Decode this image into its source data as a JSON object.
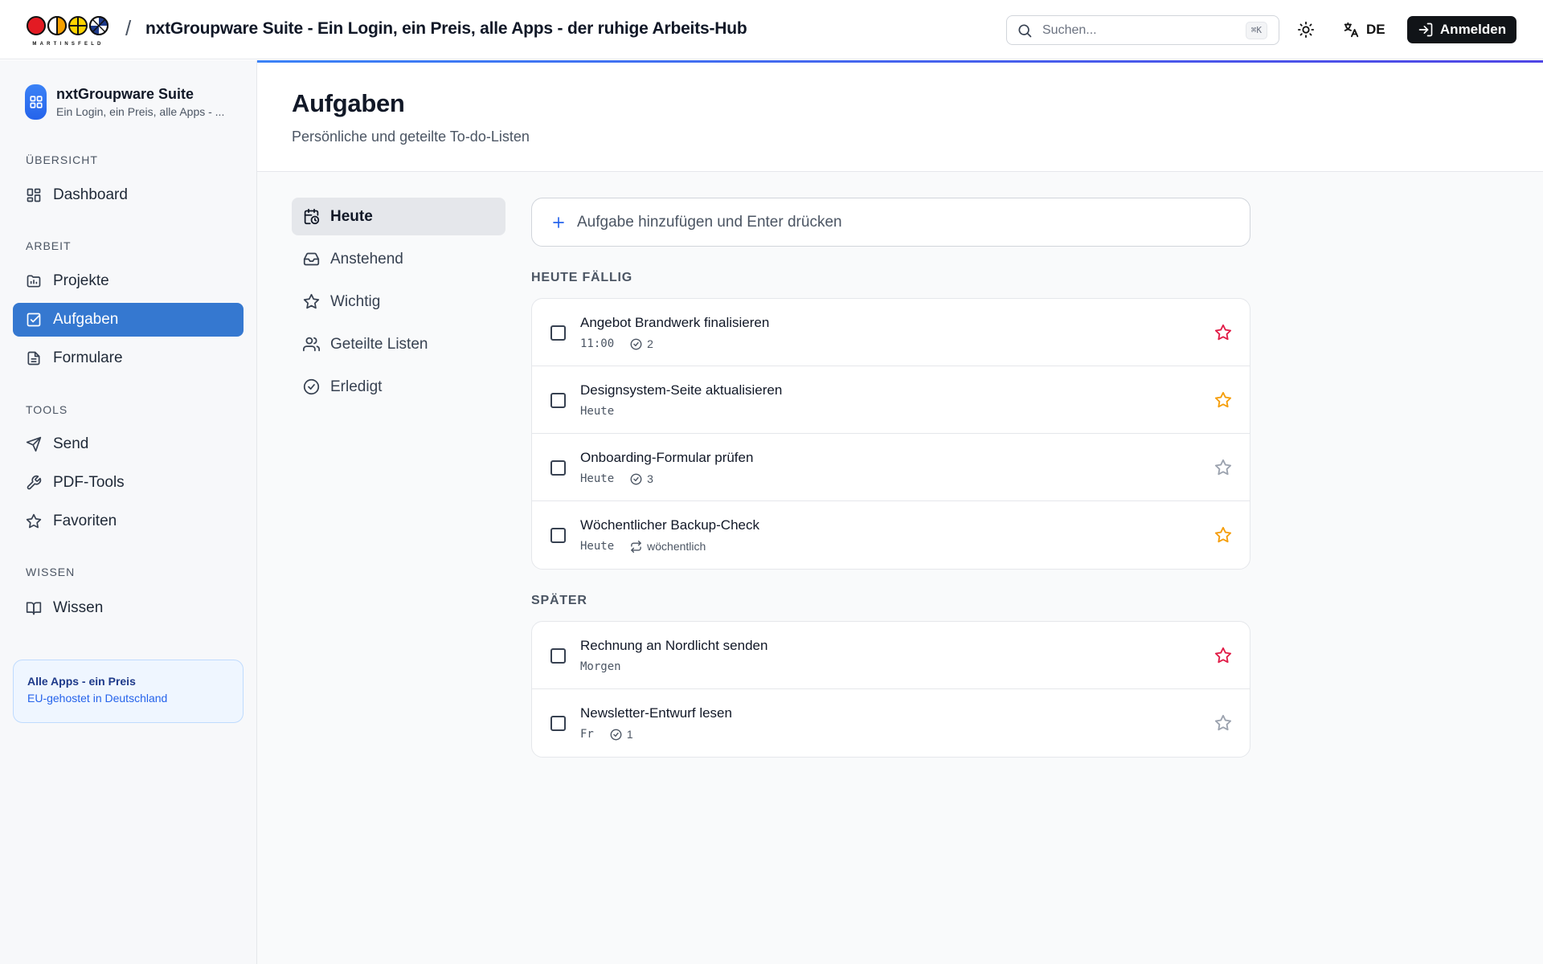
{
  "brand": {
    "logo_text": "MARTINSFELD",
    "logo_colors": [
      "#e31b23",
      "#f5a000",
      "#ffd400",
      "#1e3a8a"
    ]
  },
  "topbar": {
    "breadcrumb_separator": "/",
    "title": "nxtGroupware Suite - Ein Login, ein Preis, alle Apps - der ruhige Arbeits-Hub",
    "search_placeholder": "Suchen...",
    "search_shortcut": "⌘K",
    "language": "DE",
    "login_label": "Anmelden"
  },
  "sidebar": {
    "suite_name": "nxtGroupware Suite",
    "suite_subtitle": "Ein Login, ein Preis, alle Apps - ...",
    "sections": {
      "overview": "ÜBERSICHT",
      "work": "ARBEIT",
      "tools": "TOOLS",
      "knowledge": "WISSEN"
    },
    "items": {
      "dashboard": "Dashboard",
      "projects": "Projekte",
      "tasks": "Aufgaben",
      "forms": "Formulare",
      "send": "Send",
      "pdf_tools": "PDF-Tools",
      "favorites": "Favoriten",
      "knowledge": "Wissen"
    },
    "active_item": "Aufgaben",
    "promo": {
      "title": "Alle Apps - ein Preis",
      "subtitle": "EU-gehostet in Deutschland"
    }
  },
  "page": {
    "title": "Aufgaben",
    "subtitle": "Persönliche und geteilte To-do-Listen"
  },
  "lists": {
    "today": "Heute",
    "upcoming": "Anstehend",
    "important": "Wichtig",
    "shared": "Geteilte Listen",
    "done": "Erledigt"
  },
  "add_task_placeholder": "Aufgabe hinzufügen und Enter drücken",
  "groups": {
    "today_due": {
      "label": "HEUTE FÄLLIG",
      "tasks": [
        {
          "title": "Angebot Brandwerk finalisieren",
          "due": "11:00",
          "subtasks": "2",
          "repeat": "",
          "star": "pink"
        },
        {
          "title": "Designsystem-Seite aktualisieren",
          "due": "Heute",
          "subtasks": "",
          "repeat": "",
          "star": "orange"
        },
        {
          "title": "Onboarding-Formular prüfen",
          "due": "Heute",
          "subtasks": "3",
          "repeat": "",
          "star": "none"
        },
        {
          "title": "Wöchentlicher Backup-Check",
          "due": "Heute",
          "subtasks": "",
          "repeat": "wöchentlich",
          "star": "orange"
        }
      ]
    },
    "later": {
      "label": "SPÄTER",
      "tasks": [
        {
          "title": "Rechnung an Nordlicht senden",
          "due": "Morgen",
          "subtasks": "",
          "repeat": "",
          "star": "pink"
        },
        {
          "title": "Newsletter-Entwurf lesen",
          "due": "Fr",
          "subtasks": "1",
          "repeat": "",
          "star": "none"
        }
      ]
    }
  },
  "colors": {
    "accent": "#3578d0",
    "star_pink": "#e11d48",
    "star_orange": "#f59e0b",
    "star_none": "#9ca3af"
  }
}
